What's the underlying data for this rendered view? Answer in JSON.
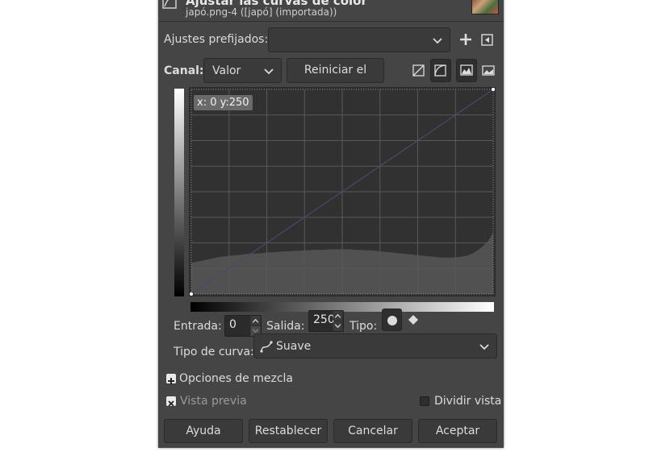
{
  "dialog": {
    "title": "Ajustar las curvas de color",
    "subtitle": "japó.png-4 ([japó] (importada))"
  },
  "presets": {
    "label": "Ajustes prefijados:",
    "value": ""
  },
  "channel": {
    "label": "Canal:",
    "value": "Valor",
    "reset_label": "Reiniciar el canal"
  },
  "graph": {
    "coord_readout": "x:  0 y:250"
  },
  "chart_data": {
    "type": "line",
    "title": "",
    "xlabel": "",
    "ylabel": "",
    "xlim": [
      0,
      255
    ],
    "ylim": [
      0,
      255
    ],
    "grid": true,
    "series": [
      {
        "values": [
          [
            0,
            0
          ],
          [
            255,
            255
          ]
        ]
      }
    ],
    "control_points": [
      [
        0,
        0
      ],
      [
        255,
        255
      ]
    ],
    "histogram": [
      60,
      62,
      64,
      66,
      68,
      70,
      72,
      73,
      74,
      75,
      76,
      77,
      78,
      78,
      79,
      80,
      80,
      81,
      82,
      82,
      83,
      83,
      84,
      84,
      85,
      85,
      85,
      86,
      86,
      86,
      86,
      86,
      85,
      85,
      84,
      84,
      83,
      82,
      81,
      80,
      79,
      78,
      77,
      76,
      75,
      74,
      73,
      72,
      71,
      70,
      70,
      70,
      71,
      72,
      74,
      78,
      84,
      92,
      102,
      118
    ]
  },
  "controls": {
    "input_label": "Entrada:",
    "input_value": "0",
    "output_label": "Salida:",
    "output_value": "250",
    "type_label": "Tipo:",
    "curve_type_label": "Tipo de curva:",
    "curve_type_value": "Suave"
  },
  "blend": {
    "label": "Opciones de mezcla"
  },
  "preview": {
    "label": "Vista previa",
    "checked": true,
    "split_label": "Dividir vista",
    "split_checked": false
  },
  "footer": {
    "help": "Ayuda",
    "reset": "Restablecer",
    "cancel": "Cancelar",
    "ok": "Aceptar"
  }
}
